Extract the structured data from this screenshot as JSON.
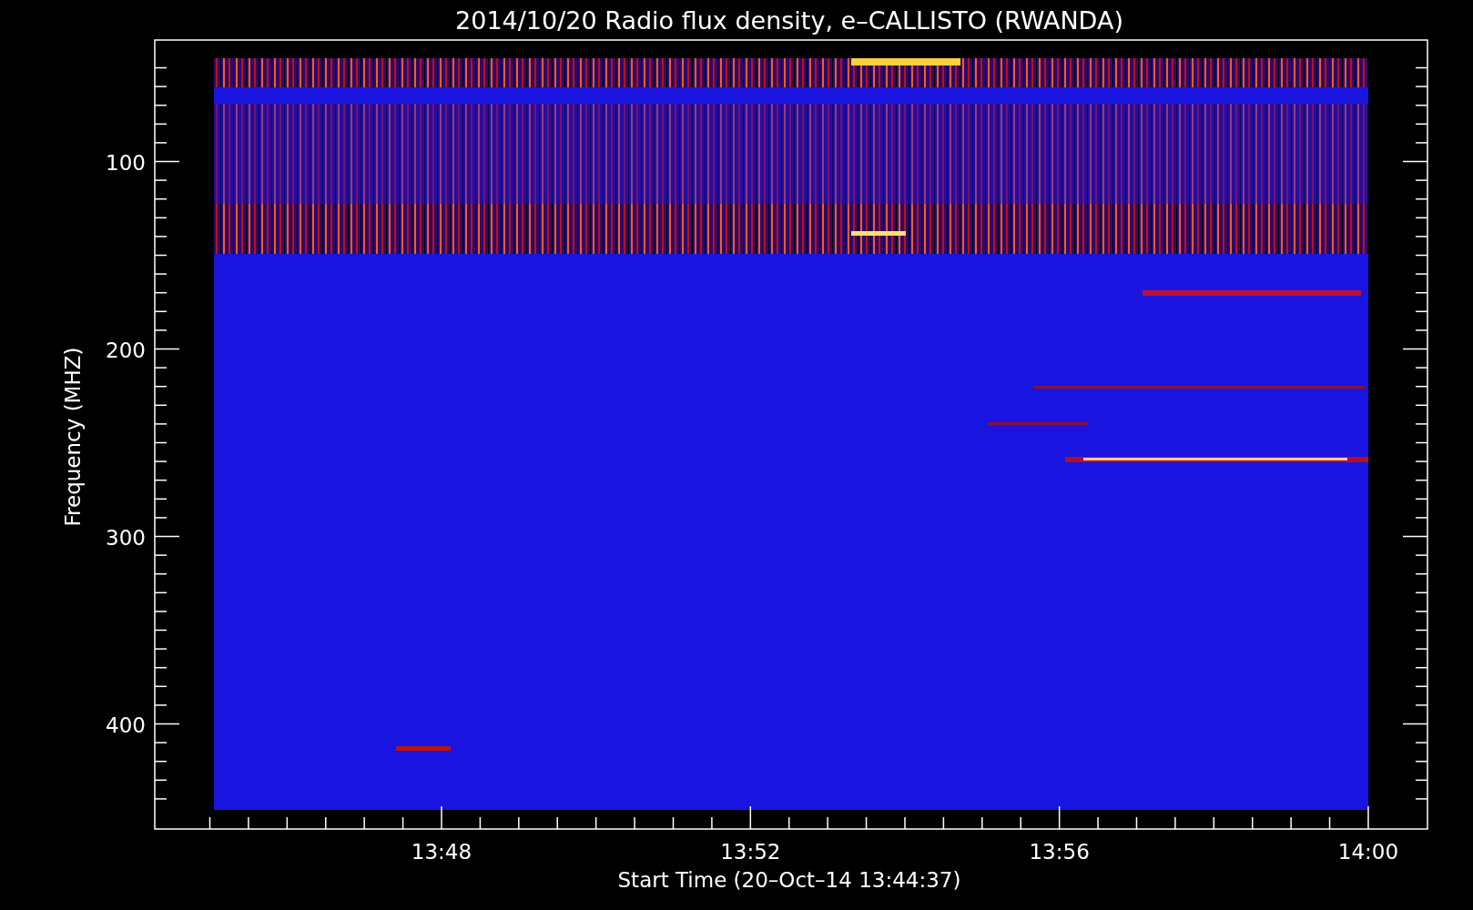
{
  "title": "2014/10/20  Radio flux density, e–CALLISTO (RWANDA)",
  "y_axis": {
    "label": "Frequency (MHZ)",
    "tick_labels": [
      "100",
      "200",
      "300",
      "400"
    ]
  },
  "x_axis": {
    "label": "Start Time (20–Oct–14 13:44:37)",
    "tick_labels": [
      "13:48",
      "13:52",
      "13:56",
      "14:00"
    ]
  }
}
